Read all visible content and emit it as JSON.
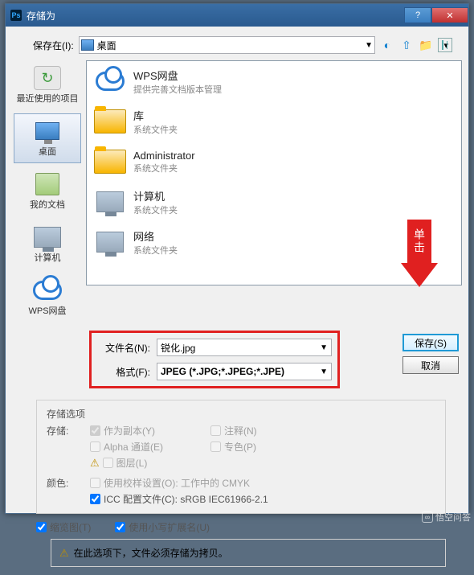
{
  "titlebar": {
    "app_icon_text": "Ps",
    "title": "存储为"
  },
  "winbtns": {
    "help": "?",
    "close": "✕"
  },
  "location": {
    "label": "保存在(I):",
    "selected": "桌面",
    "toolbar": {
      "view_dropdown": "▾"
    }
  },
  "sidebar": {
    "items": [
      {
        "label": "最近使用的项目"
      },
      {
        "label": "桌面"
      },
      {
        "label": "我的文档"
      },
      {
        "label": "计算机"
      },
      {
        "label": "WPS网盘"
      }
    ]
  },
  "listing": [
    {
      "icon": "cloud",
      "title": "WPS网盘",
      "subtitle": "提供完善文档版本管理"
    },
    {
      "icon": "folder",
      "title": "库",
      "subtitle": "系统文件夹"
    },
    {
      "icon": "folder",
      "title": "Administrator",
      "subtitle": "系统文件夹"
    },
    {
      "icon": "computer",
      "title": "计算机",
      "subtitle": "系统文件夹"
    },
    {
      "icon": "netcomputer",
      "title": "网络",
      "subtitle": "系统文件夹"
    }
  ],
  "fields": {
    "filename_label": "文件名(N):",
    "filename_value": "锐化.jpg",
    "format_label": "格式(F):",
    "format_value": "JPEG (*.JPG;*.JPEG;*.JPE)"
  },
  "buttons": {
    "save": "保存(S)",
    "cancel": "取消"
  },
  "callout": {
    "text": "单击"
  },
  "options": {
    "section_title": "存储选项",
    "store_label": "存储:",
    "as_copy": "作为副本(Y)",
    "annotations": "注释(N)",
    "alpha": "Alpha 通道(E)",
    "spot": "专色(P)",
    "layers": "图层(L)",
    "color_label": "颜色:",
    "proof": "使用校样设置(O):  工作中的 CMYK",
    "icc": "ICC 配置文件(C):  sRGB IEC61966-2.1",
    "thumbnail": "缩览图(T)",
    "lowercase_ext": "使用小写扩展名(U)"
  },
  "note": {
    "text": "在此选项下，文件必须存储为拷贝。"
  },
  "watermark": "悟空问答"
}
